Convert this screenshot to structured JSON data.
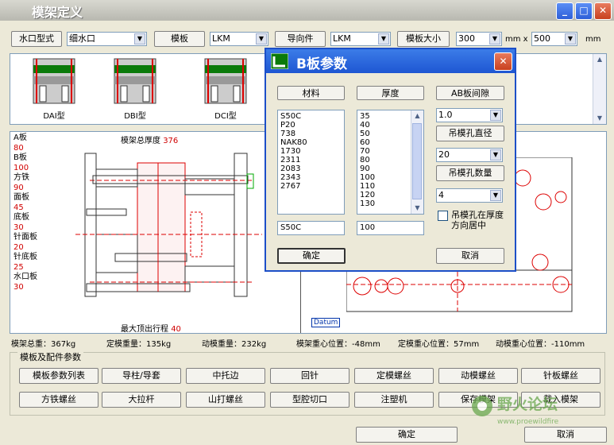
{
  "window": {
    "title": "模架定义",
    "min": "_",
    "max": "□",
    "close": "✕"
  },
  "toolbar": {
    "gate_type_label": "水口型式",
    "gate_type_value": "细水口",
    "mold_label": "模板",
    "mold_value": "LKM",
    "guide_label": "导向件",
    "guide_value": "LKM",
    "size_label": "模板大小",
    "width_value": "300",
    "mm_x": "mm x",
    "height_value": "500",
    "mm": "mm"
  },
  "thumbnails": [
    {
      "label": "DAI型"
    },
    {
      "label": "DBI型"
    },
    {
      "label": "DCI型"
    }
  ],
  "left_plates": [
    {
      "name": "A板",
      "value": "80"
    },
    {
      "name": "B板",
      "value": "100"
    },
    {
      "name": "方铁",
      "value": "90"
    },
    {
      "name": "面板",
      "value": "45"
    },
    {
      "name": "底板",
      "value": "30"
    },
    {
      "name": "针面板",
      "value": "20"
    },
    {
      "name": "针底板",
      "value": "25"
    },
    {
      "name": "水口板",
      "value": "30"
    }
  ],
  "drawing": {
    "total_thickness_label": "模架总厚度",
    "total_thickness_value": "376",
    "max_eject_label": "最大顶出行程",
    "max_eject_value": "40",
    "datum": "Datum"
  },
  "status": {
    "total_weight": "模架总重：367kg",
    "fixed_weight": "定模重量：135kg",
    "moving_weight": "动模重量：232kg",
    "center": "模架重心位置：-48mm",
    "fixed_center": "定模重心位置：57mm",
    "moving_center": "动模重心位置：-110mm"
  },
  "group": {
    "title": "模板及配件参数",
    "row1": [
      "模板参数列表",
      "导柱/导套",
      "中托边",
      "回针",
      "定模螺丝",
      "动模螺丝",
      "针板螺丝"
    ],
    "row2": [
      "方铁螺丝",
      "大拉杆",
      "山打螺丝",
      "型腔切口",
      "注塑机",
      "保存模架",
      "载入模架"
    ]
  },
  "footer": {
    "ok": "确定",
    "cancel": "取消"
  },
  "watermark": {
    "text": "野火论坛",
    "url": "www.proewildfire"
  },
  "dialog": {
    "title": "B板参数",
    "material_label": "材料",
    "thickness_label": "厚度",
    "ab_gap_label": "AB板间隙",
    "materials": [
      "S50C",
      "P20",
      "738",
      "NAK80",
      "1730",
      "2311",
      "2083",
      "2343",
      "2767"
    ],
    "thicknesses": [
      "35",
      "40",
      "50",
      "60",
      "70",
      "80",
      "90",
      "100",
      "110",
      "120",
      "130"
    ],
    "ab_gap_value": "1.0",
    "hole_diameter_label": "吊模孔直径",
    "hole_diameter_value": "20",
    "hole_count_label": "吊模孔数量",
    "hole_count_value": "4",
    "center_checkbox_label": "吊模孔在厚度方向居中",
    "material_value": "S50C",
    "thickness_value": "100",
    "ok": "确定",
    "cancel": "取消"
  }
}
